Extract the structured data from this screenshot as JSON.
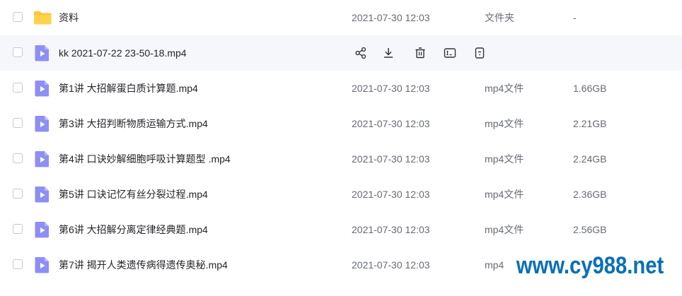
{
  "colors": {
    "folder": "#ffc53d",
    "video": "#8d8ff5",
    "hover_row": "#f6f7fa",
    "watermark": "#0a6fb8"
  },
  "files": [
    {
      "name": "资料",
      "date": "2021-07-30 12:03",
      "type": "文件夹",
      "size": "-",
      "icon": "folder-icon"
    },
    {
      "name": "kk 2021-07-22 23-50-18.mp4",
      "date": "",
      "type": "",
      "size": "",
      "icon": "video-file-icon",
      "hovered": true
    },
    {
      "name": "第1讲 大招解蛋白质计算题.mp4",
      "date": "2021-07-30 12:03",
      "type": "mp4文件",
      "size": "1.66GB",
      "icon": "video-file-icon"
    },
    {
      "name": "第3讲 大招判断物质运输方式.mp4",
      "date": "2021-07-30 12:03",
      "type": "mp4文件",
      "size": "2.21GB",
      "icon": "video-file-icon"
    },
    {
      "name": "第4讲 口诀妙解细胞呼吸计算题型 .mp4",
      "date": "2021-07-30 12:03",
      "type": "mp4文件",
      "size": "2.24GB",
      "icon": "video-file-icon"
    },
    {
      "name": "第5讲 口诀记忆有丝分裂过程.mp4",
      "date": "2021-07-30 12:03",
      "type": "mp4文件",
      "size": "2.36GB",
      "icon": "video-file-icon"
    },
    {
      "name": "第6讲 大招解分离定律经典题.mp4",
      "date": "2021-07-30 12:03",
      "type": "mp4文件",
      "size": "2.56GB",
      "icon": "video-file-icon"
    },
    {
      "name": "第7讲 揭开人类遗传病得遗传奥秘.mp4",
      "date": "2021-07-30 12:03",
      "type": "mp4",
      "size": "",
      "icon": "video-file-icon"
    }
  ],
  "row_actions": [
    "share-icon",
    "download-icon",
    "delete-icon",
    "rename-icon",
    "more-icon"
  ],
  "watermark": "www.cy988.net"
}
